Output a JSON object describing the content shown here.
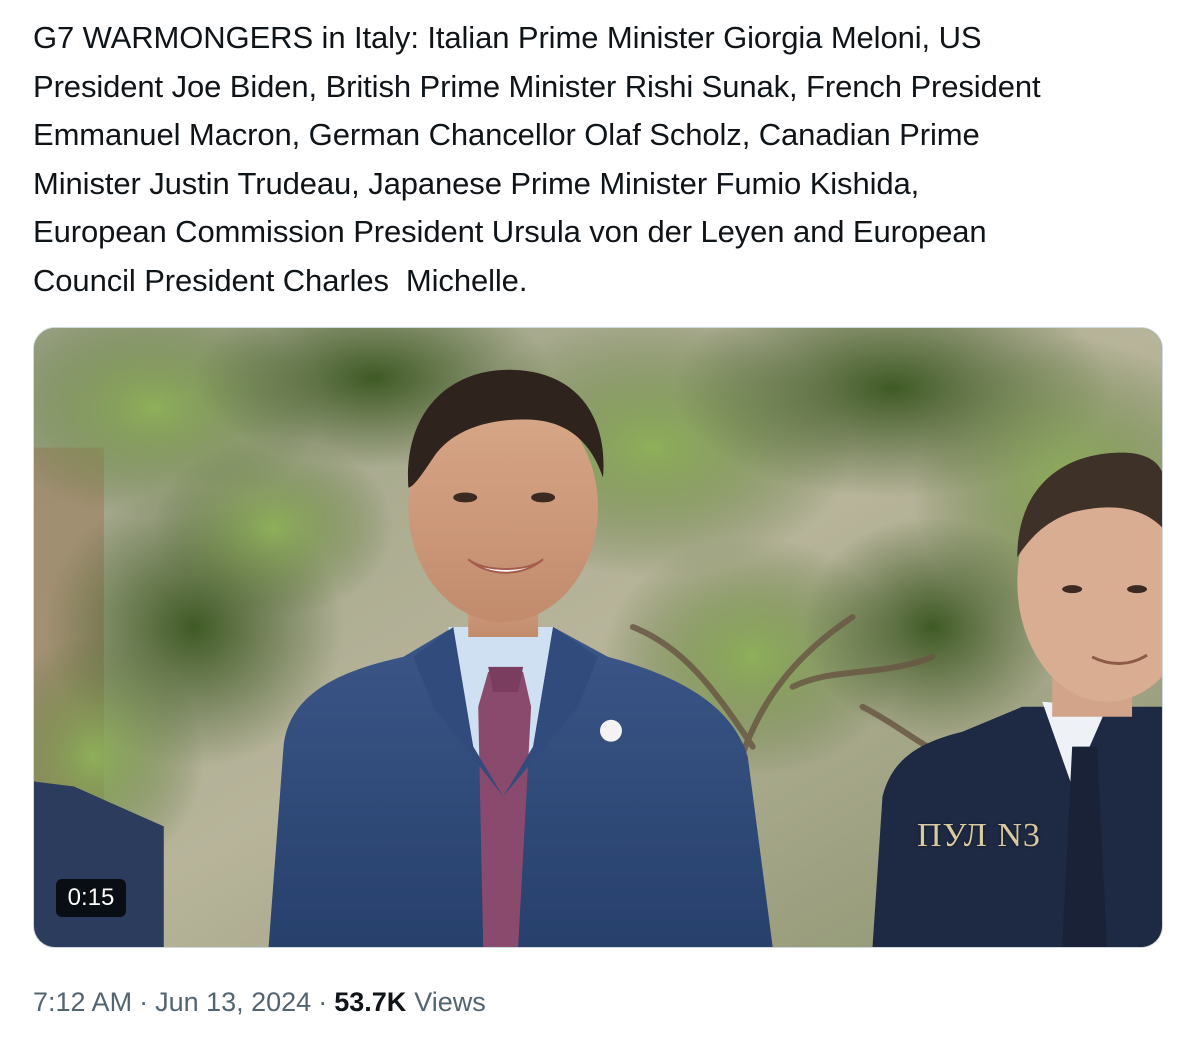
{
  "tweet": {
    "text": "G7 WARMONGERS in Italy: Italian Prime Minister Giorgia Meloni, US\nPresident Joe Biden, British Prime Minister Rishi Sunak, French President\nEmmanuel Macron, German Chancellor Olaf Scholz, Canadian Prime\nMinister Justin Trudeau, Japanese Prime Minister Fumio Kishida,\nEuropean Commission President Ursula von der Leyen and European\nCouncil President Charles  Michelle."
  },
  "media": {
    "type": "video",
    "duration": "0:15",
    "watermark": "ПУЛ N3"
  },
  "meta": {
    "time": "7:12 AM",
    "separator": "·",
    "date": "Jun 13, 2024",
    "views_count": "53.7K",
    "views_label": "Views"
  },
  "colors": {
    "text_primary": "#0f1419",
    "text_secondary": "#536471",
    "media_border": "#cfd9de",
    "suit_blue": "#2f4a7a",
    "foliage_green": "#5f7d3c"
  }
}
